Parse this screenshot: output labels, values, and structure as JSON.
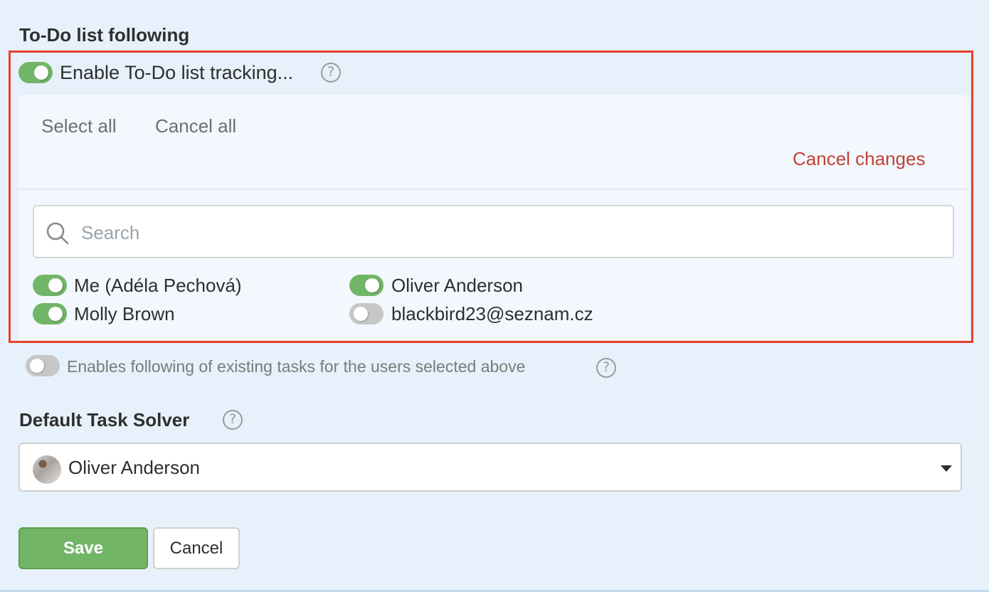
{
  "section": {
    "title": "To-Do list following"
  },
  "tracking": {
    "enabled": true,
    "label": "Enable To-Do list tracking...",
    "help_icon": "question-circle-icon"
  },
  "panel": {
    "select_all": "Select all",
    "cancel_all": "Cancel all",
    "cancel_changes": "Cancel changes",
    "search": {
      "placeholder": "Search",
      "value": "",
      "icon": "search-icon"
    },
    "users": [
      {
        "name": "Me (Adéla Pechová)",
        "enabled": true
      },
      {
        "name": "Oliver Anderson",
        "enabled": true
      },
      {
        "name": "Molly Brown",
        "enabled": true
      },
      {
        "name": "blackbird23@seznam.cz",
        "enabled": false
      }
    ]
  },
  "existing_tasks": {
    "enabled": false,
    "label": "Enables following of existing tasks for the users selected above",
    "help_icon": "question-circle-icon"
  },
  "default_solver": {
    "title": "Default Task Solver",
    "help_icon": "question-circle-icon",
    "selected": "Oliver Anderson",
    "avatar": "user-avatar"
  },
  "actions": {
    "save": "Save",
    "cancel": "Cancel"
  },
  "colors": {
    "accent_green": "#72b567",
    "toggle_off": "#c7c7c7",
    "danger_red": "#c64036",
    "highlight_border": "#e5412d",
    "background": "#e7f1fb"
  }
}
